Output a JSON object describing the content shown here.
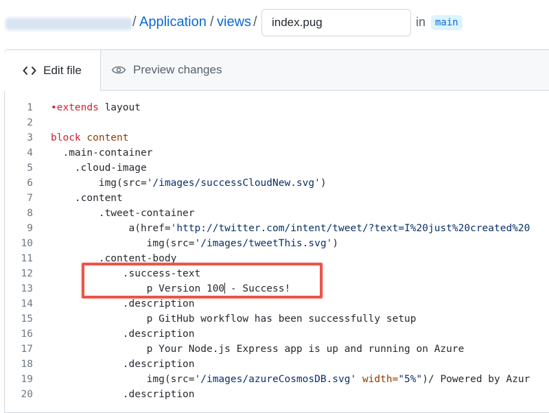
{
  "breadcrumb": {
    "owner_hidden": "",
    "items": [
      "Application",
      "views"
    ],
    "separator": "/",
    "filename_value": "index.pug",
    "in_label": "in",
    "branch": "main"
  },
  "tabs": {
    "edit": "Edit file",
    "preview": "Preview changes"
  },
  "code": {
    "lines": [
      {
        "n": "1"
      },
      {
        "n": "2"
      },
      {
        "n": "3"
      },
      {
        "n": "4"
      },
      {
        "n": "5"
      },
      {
        "n": "6"
      },
      {
        "n": "7"
      },
      {
        "n": "8"
      },
      {
        "n": "9"
      },
      {
        "n": "10"
      },
      {
        "n": "11"
      },
      {
        "n": "12"
      },
      {
        "n": "13"
      },
      {
        "n": "14"
      },
      {
        "n": "15"
      },
      {
        "n": "16"
      },
      {
        "n": "17"
      },
      {
        "n": "18"
      },
      {
        "n": "19"
      },
      {
        "n": "20"
      }
    ],
    "text": {
      "l1_kw": "extends",
      "l1_rest": " layout",
      "l3_kw": "block",
      "l3_rest": " content",
      "l4": "  .main-container",
      "l5": "    .cloud-image",
      "l6a": "        img(src=",
      "l6b": "'/images/successCloudNew.svg'",
      "l6c": ")",
      "l7": "    .content",
      "l8": "        .tweet-container",
      "l9a": "             a(href=",
      "l9b": "'http://twitter.com/intent/tweet/?text=I%20just%20created%20",
      "l10a": "                img(src=",
      "l10b": "'/images/tweetThis.svg'",
      "l10c": ")",
      "l11": "        .content-body",
      "l12": "            .success-text",
      "l13a": "                p Version 100",
      "l13b": " - Success!",
      "l14": "            .description",
      "l15": "                p GitHub workflow has been successfully setup",
      "l16": "            .description",
      "l17": "                p Your Node.js Express app is up and running on Azure",
      "l18": "            .description",
      "l19a": "                img(src=",
      "l19b": "'/images/azureCosmosDB.svg'",
      "l19c": " width=",
      "l19d": "\"5%\"",
      "l19e": ")/ Powered by Azur",
      "l20": "            .description"
    }
  },
  "colors": {
    "link": "#0969da",
    "highlight_box": "#e8564a",
    "keyword": "#cf222e",
    "branch_bg": "#ddf4ff"
  },
  "icons": {
    "edit_tab": "code-brackets-icon",
    "preview_tab": "eye-icon"
  }
}
